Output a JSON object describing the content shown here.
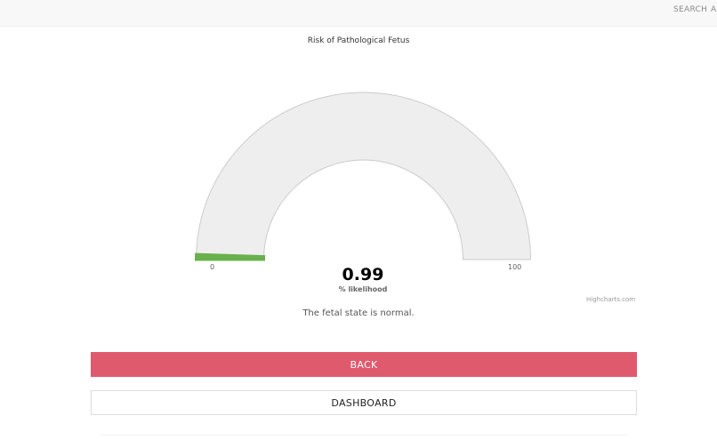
{
  "nav": {
    "search_label": "SEARCH",
    "next_label_partial": "A"
  },
  "chart_data": {
    "type": "gauge",
    "title": "Risk of Pathological Fetus",
    "value": 0.99,
    "value_label": "0.99",
    "unit_label": "% likelihood",
    "min": 0,
    "max": 100,
    "min_label": "0",
    "max_label": "100",
    "credits": "Highcharts.com",
    "colors": {
      "track": "#eeeeee",
      "track_border": "#cccccc",
      "fill": "#6ab04c"
    }
  },
  "result": {
    "status_text": "The fetal state is normal."
  },
  "buttons": {
    "back_label": "BACK",
    "dashboard_label": "DASHBOARD"
  },
  "colors": {
    "accent": "#e05a6d"
  }
}
